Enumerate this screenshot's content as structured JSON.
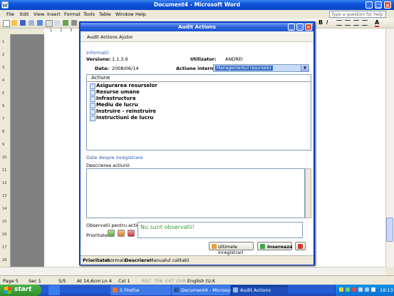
{
  "word": {
    "title": "Document4 - Microsoft Word",
    "menu": [
      "File",
      "Edit",
      "View",
      "Insert",
      "Format",
      "Tools",
      "Table",
      "Window",
      "Help"
    ],
    "help_placeholder": "Type a question for help",
    "toolbar_text": {
      "bold": "B",
      "italic": "I",
      "underline": "U",
      "font_color": "A"
    },
    "ruler_ticks": [
      "1",
      "2",
      "3",
      "4",
      "5",
      "6",
      "7",
      "8",
      "9",
      "10",
      "11",
      "12",
      "13",
      "14",
      "15",
      "16",
      "17",
      "18"
    ],
    "left_ruler_ticks": [
      "1",
      "2",
      "3",
      "4",
      "5",
      "6",
      "7",
      "8",
      "9",
      "10",
      "11",
      "12",
      "13",
      "14",
      "15",
      "16",
      "17",
      "18"
    ],
    "status": {
      "page": "Page 5",
      "sec": "Sec 1",
      "pages": "5/5",
      "at": "At 14,6cm",
      "ln": "Ln 4",
      "col": "Col 1",
      "rec": "REC",
      "trk": "TRK",
      "ext": "EXT",
      "ovr": "OVR",
      "language": "English (U.K"
    }
  },
  "dialog": {
    "title": "Audit Actions",
    "menu": [
      "Audit Actions",
      "Ajutor"
    ],
    "section_info": "Informatii",
    "version_label": "Versiune:",
    "version_value": "1.1.3.6",
    "user_label": "Utilizator:",
    "user_value": "ANDREI",
    "date_label": "Data:",
    "date_value": "2008/06/14",
    "action_label": "Actiune interna:",
    "action_value": "Managementul resurselor",
    "list_header": "Actiune",
    "list_items": [
      "Asigurarea resurselor",
      "Resurse umane",
      "Infrastructura",
      "Mediu de lucru",
      "Instruire - reinstruire",
      "Instructiuni de lucru"
    ],
    "section_record": "Date despre inregistrare",
    "description_label": "Descrierea actiunii",
    "observations_label": "Observatii pentru actiune",
    "observations_value": "Nu sunt observatii!",
    "priority_label": "Prioritate:",
    "btn_last": "Ultimele inregistrari",
    "btn_insert": "Insereaza",
    "status": {
      "priority_label": "Prioritate:",
      "priority_value": "Normala",
      "description_label": "Descriere:",
      "description_value": "Manualul calitatii"
    }
  },
  "taskbar": {
    "start": "start",
    "tasks": [
      "5 Firefox",
      "Document4 - Microsof...",
      "Audit Actions"
    ],
    "clock": "18:13"
  }
}
